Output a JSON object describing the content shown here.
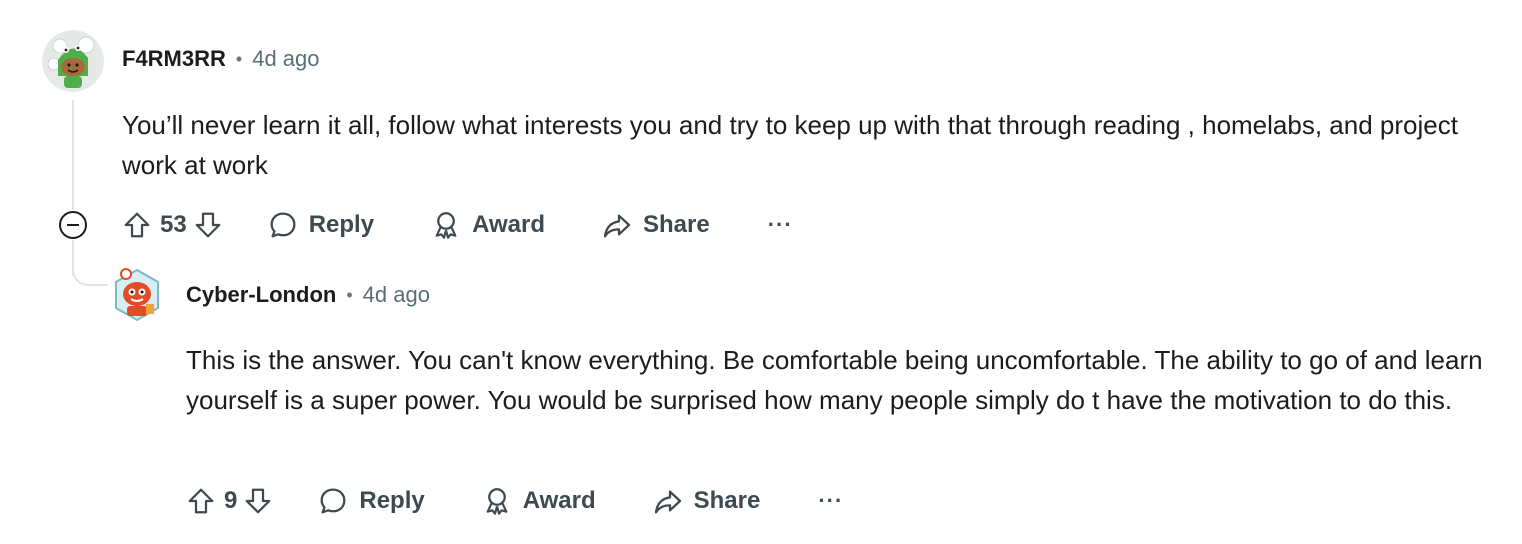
{
  "comments": [
    {
      "author": "F4RM3RR",
      "separator": "•",
      "time": "4d ago",
      "text": "You’ll never learn it all, follow what interests you and try to keep up with that through reading , homelabs, and project work at work",
      "votes": "53",
      "actions": {
        "reply": "Reply",
        "award": "Award",
        "share": "Share",
        "more": "···"
      },
      "avatar_colors": {
        "bg": "#e6eae7",
        "accent": "#4fae4a"
      }
    },
    {
      "author": "Cyber-London",
      "separator": "•",
      "time": "4d ago",
      "text": "This is the answer. You can't know everything. Be comfortable being uncomfortable. The ability to go of and learn yourself is a super power. You would be surprised how many people simply do t have the motivation to do this.",
      "votes": "9",
      "actions": {
        "reply": "Reply",
        "award": "Award",
        "share": "Share",
        "more": "···"
      },
      "avatar_colors": {
        "bg": "#d9eef2",
        "accent": "#e24b25"
      }
    }
  ],
  "icons": {
    "upvote": "arrow-up-icon",
    "downvote": "arrow-down-icon",
    "reply": "speech-bubble-icon",
    "award": "award-ribbon-icon",
    "share": "share-arrow-icon",
    "collapse": "minus-circle-icon"
  },
  "colors": {
    "text": "#1c1c1c",
    "meta": "#576f76",
    "action": "#3e4a50",
    "thread_line": "#e1e4e7"
  }
}
